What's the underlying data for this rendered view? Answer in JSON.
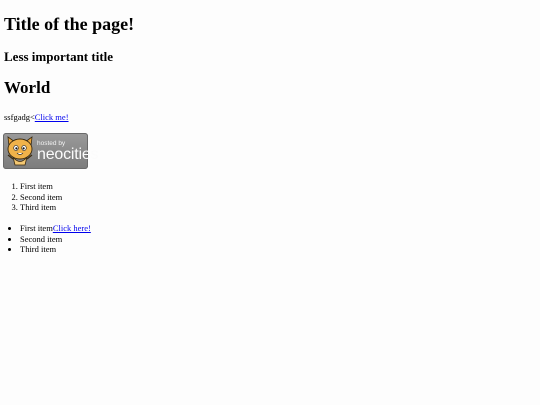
{
  "headings": {
    "h1": "Title of the page!",
    "h2": "Less important title",
    "h3": "World"
  },
  "line": {
    "text": "ssfgadg<",
    "link": "Click me!"
  },
  "badge": {
    "small_text": "hosted by",
    "big_text": "neocities",
    "icon": "neocities-cat-logo"
  },
  "ordered_list": [
    "First item",
    "Second item",
    "Third item"
  ],
  "unordered_list": {
    "first_text": "First item",
    "first_link": "Click here!",
    "second": "Second item",
    "third": "Third item"
  },
  "colors": {
    "link": "#0000ee",
    "background": "#fdfdfd"
  }
}
